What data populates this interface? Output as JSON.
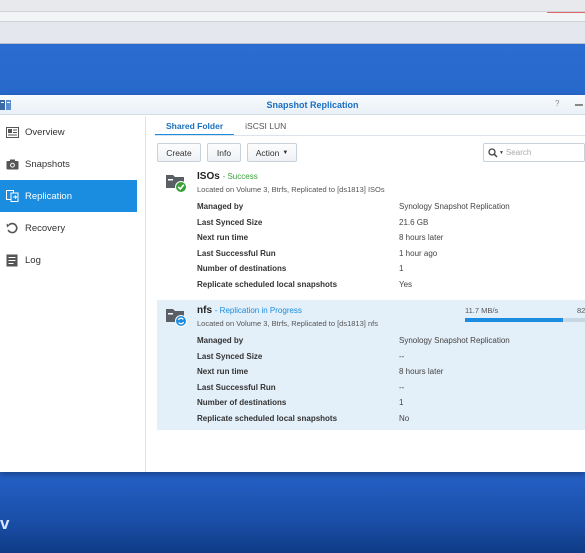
{
  "window": {
    "title": "Snapshot Replication"
  },
  "sidebar": {
    "items": [
      {
        "label": "Overview",
        "icon": "overview-icon",
        "active": false
      },
      {
        "label": "Snapshots",
        "icon": "camera-icon",
        "active": false
      },
      {
        "label": "Replication",
        "icon": "replication-icon",
        "active": true
      },
      {
        "label": "Recovery",
        "icon": "recovery-icon",
        "active": false
      },
      {
        "label": "Log",
        "icon": "log-icon",
        "active": false
      }
    ]
  },
  "tabs": [
    {
      "label": "Shared Folder",
      "active": true
    },
    {
      "label": "iSCSI LUN",
      "active": false
    }
  ],
  "toolbar": {
    "create_label": "Create",
    "info_label": "Info",
    "action_label": "Action",
    "search_placeholder": "Search"
  },
  "tasks": [
    {
      "name": "ISOs",
      "status": "- Success",
      "status_color": "#3aa03a",
      "location": "Located on Volume 3, Btrfs, Replicated to [ds1813] ISOs",
      "fields": [
        {
          "key": "Managed by",
          "value": "Synology Snapshot Replication"
        },
        {
          "key": "Last Synced Size",
          "value": "21.6 GB"
        },
        {
          "key": "Next run time",
          "value": "8 hours later"
        },
        {
          "key": "Last Successful Run",
          "value": "1 hour ago"
        },
        {
          "key": "Number of destinations",
          "value": "1"
        },
        {
          "key": "Replicate scheduled local snapshots",
          "value": "Yes"
        }
      ]
    },
    {
      "name": "nfs",
      "status": "- Replication in Progress",
      "status_color": "#1a8de0",
      "location": "Located on Volume 3, Btrfs, Replicated to [ds1813] nfs",
      "speed": "11.7 MB/s",
      "progress_label": "82",
      "progress_fraction": 0.82,
      "fields": [
        {
          "key": "Managed by",
          "value": "Synology Snapshot Replication"
        },
        {
          "key": "Last Synced Size",
          "value": "--"
        },
        {
          "key": "Next run time",
          "value": "8 hours later"
        },
        {
          "key": "Last Successful Run",
          "value": "--"
        },
        {
          "key": "Number of destinations",
          "value": "1"
        },
        {
          "key": "Replicate scheduled local snapshots",
          "value": "No"
        }
      ]
    }
  ],
  "desktop": {
    "corner_text": "v"
  },
  "colors": {
    "accent": "#1a8de0",
    "title": "#1a6fc0",
    "selected_row": "#e3eff9"
  }
}
